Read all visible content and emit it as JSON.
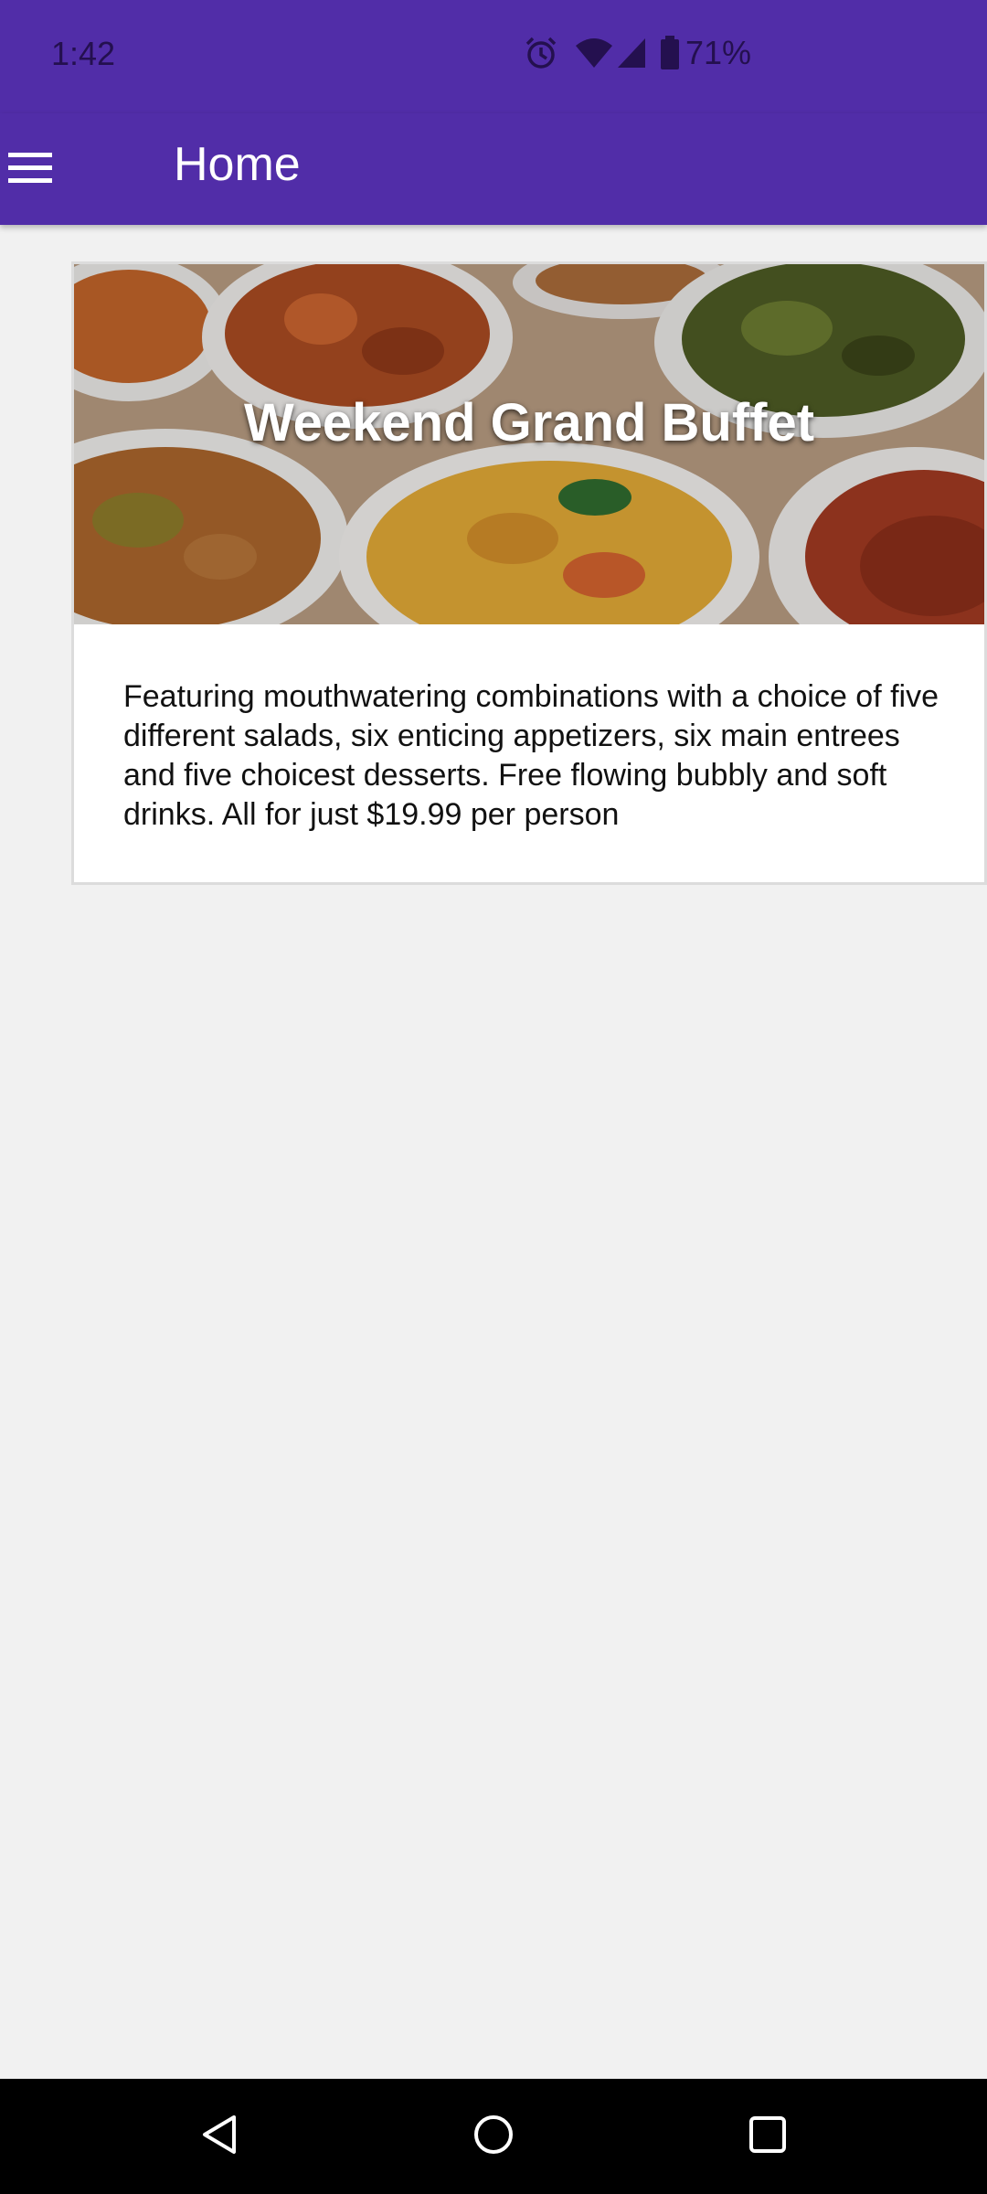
{
  "status_bar": {
    "time": "1:42",
    "battery": "71%",
    "icons": [
      "alarm-icon",
      "wifi-icon",
      "signal-icon",
      "battery-icon"
    ]
  },
  "app_bar": {
    "title": "Home",
    "menu_icon": "hamburger-menu-icon",
    "background_color": "#512DA8"
  },
  "card": {
    "image": "buffet-food-image",
    "title": "Weekend Grand Buffet",
    "description": "Featuring mouthwatering combinations with a choice of five different salads, six enticing appetizers, six main entrees and five choicest desserts. Free flowing bubbly and soft drinks. All for just $19.99 per person"
  },
  "nav_bar": {
    "buttons": [
      "back-icon",
      "home-icon",
      "recents-icon"
    ]
  }
}
